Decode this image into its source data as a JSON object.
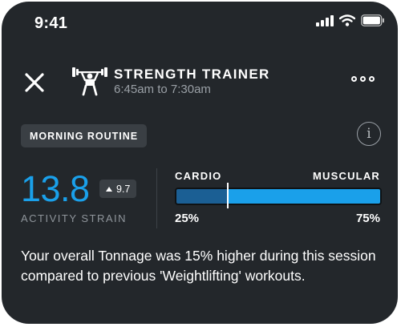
{
  "status_bar": {
    "time": "9:41",
    "icons": [
      "signal-icon",
      "wifi-icon",
      "battery-icon"
    ]
  },
  "header": {
    "title": "STRENGTH TRAINER",
    "time_range": "6:45am to 7:30am",
    "icons": [
      "close-icon",
      "barbell-trainer-icon",
      "more-icon"
    ]
  },
  "routine_tag": "MORNING ROUTINE",
  "info_icon": "info-icon",
  "strain": {
    "value": "13.8",
    "delta": "9.7",
    "label": "ACTIVITY STRAIN"
  },
  "split": {
    "cardio_label": "CARDIO",
    "muscular_label": "MUSCULAR",
    "cardio_pct": "25%",
    "muscular_pct": "75%",
    "cardio_fraction": 0.25
  },
  "insight": "Your overall Tonnage was 15% higher during this session compared to previous 'Weightlifting' workouts.",
  "colors": {
    "background": "#23272b",
    "accent_blue": "#1aa0ea",
    "cardio_blue": "#1b5f94",
    "muted_text": "#9aa0a6",
    "tag_bg": "#3a3f44"
  }
}
